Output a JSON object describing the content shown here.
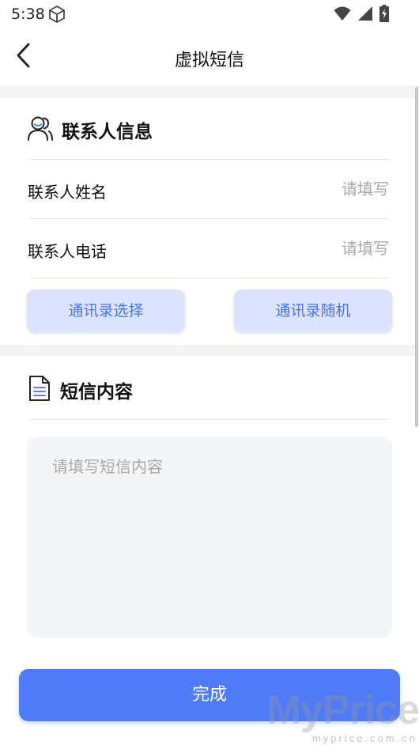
{
  "status_bar": {
    "time": "5:38",
    "icons": [
      "cube-icon",
      "wifi-icon",
      "signal-icon",
      "battery-charging-icon"
    ]
  },
  "nav": {
    "title": "虚拟短信",
    "back_icon": "chevron-left-icon"
  },
  "contact_section": {
    "title": "联系人信息",
    "icon": "contact-icon",
    "fields": [
      {
        "label": "联系人姓名",
        "placeholder": "请填写",
        "value": ""
      },
      {
        "label": "联系人电话",
        "placeholder": "请填写",
        "value": ""
      }
    ],
    "buttons": {
      "select_contact": "通讯录选择",
      "random_contact": "通讯录随机"
    }
  },
  "sms_section": {
    "title": "短信内容",
    "icon": "document-icon",
    "placeholder": "请填写短信内容",
    "value": ""
  },
  "submit_label": "完成",
  "watermark": {
    "logo": "MyPrice",
    "url": "myprice.com.cn"
  },
  "colors": {
    "accent": "#4f7bf7",
    "pill_bg": "#dbe3ff",
    "pill_text": "#4a73e8",
    "page_band": "#f3f4f6",
    "placeholder": "#a8a8a8"
  }
}
